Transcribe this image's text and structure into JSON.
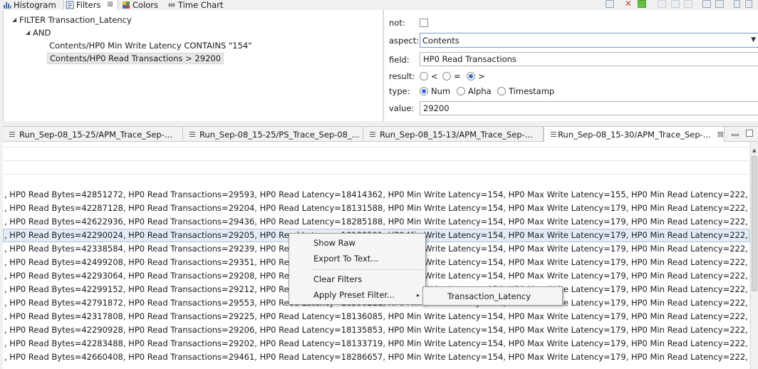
{
  "top_tabs": [
    {
      "label": "Histogram",
      "icon": "histogram-icon"
    },
    {
      "label": "Filters",
      "icon": "filter-icon",
      "close": "⊠"
    },
    {
      "label": "Colors",
      "icon": "colors-icon"
    },
    {
      "label": "Time Chart",
      "icon": "time-chart-icon"
    }
  ],
  "filter_tree": {
    "root": "FILTER Transaction_Latency",
    "and": "AND",
    "conditions": [
      "Contents/HP0 Min Write Latency CONTAINS \"154\"",
      "Contents/HP0 Read Transactions > 29200"
    ]
  },
  "properties": {
    "not_label": "not:",
    "aspect_label": "aspect:",
    "aspect_value": "Contents",
    "field_label": "field:",
    "field_value": "HP0 Read Transactions",
    "result_label": "result:",
    "result_options": [
      "<",
      "=",
      ">"
    ],
    "result_selected": ">",
    "type_label": "type:",
    "type_options": [
      "Num",
      "Alpha",
      "Timestamp"
    ],
    "type_selected": "Num",
    "value_label": "value:",
    "value_value": "29200"
  },
  "trace_tabs": [
    "Run_Sep-08_15-25/APM_Trace_Sep-...",
    "Run_Sep-08_15-25/PS_Trace_Sep-08_...",
    "Run_Sep-08_15-13/APM_Trace_Sep-...",
    "Run_Sep-08_15-30/APM_Trace_Sep-..."
  ],
  "log_rows": [
    ", HP0 Read Bytes=42851272, HP0 Read Transactions=29593, HP0 Read Latency=18414362, HP0 Min Write Latency=154, HP0 Max Write Latency=155, HP0 Min Read Latency=222, HP0 Max Read Late",
    ", HP0 Read Bytes=42287128, HP0 Read Transactions=29204, HP0 Read Latency=18131588, HP0 Min Write Latency=154, HP0 Max Write Latency=179, HP0 Min Read Latency=222, HP0 Max Read Late",
    ", HP0 Read Bytes=42622936, HP0 Read Transactions=29436, HP0 Read Latency=18285188, HP0 Min Write Latency=154, HP0 Max Write Latency=179, HP0 Min Read Latency=222, HP0 Max Read Late",
    ", HP0 Read Bytes=42290024, HP0 Read Transactions=29205, HP0 Read Latency=18133591, HP0 Min Write Latency=154, HP0 Max Write Latency=179, HP0 Min Read Latency=222, HP0 Max Read Late",
    ", HP0 Read Bytes=42338584, HP0 Read Transactions=29239, HP0 Read Latency=18163420, HP0 Min Write Latency=154, HP0 Max Write Latency=179, HP0 Min Read Latency=222, HP0 Max Read Late",
    ", HP0 Read Bytes=42499208, HP0 Read Transactions=29351, HP0 Read Latency=18231754, HP0 Min Write Latency=154, HP0 Max Write Latency=179, HP0 Min Read Latency=222, HP0 Max Read Late",
    ", HP0 Read Bytes=42293064, HP0 Read Transactions=29208, HP0 Read Latency=18134820, HP0 Min Write Latency=154, HP0 Max Write Latency=179, HP0 Min Read Latency=222, HP0 Max Read Late",
    ", HP0 Read Bytes=42299152, HP0 Read Transactions=29212, HP0 Read Latency=18137012, HP0 Min Write Latency=154, HP0 Max Write Latency=179, HP0 Min Read Latency=222, HP0 Max Read Late",
    ", HP0 Read Bytes=42791872, HP0 Read Transactions=29553, HP0 Read Latency=18390211, HP0 Min Write Latency=154, HP0 Max Write Latency=179, HP0 Min Read Latency=222, HP0 Max Read Late",
    ", HP0 Read Bytes=42317808, HP0 Read Transactions=29225, HP0 Read Latency=18136085, HP0 Min Write Latency=154, HP0 Max Write Latency=179, HP0 Min Read Latency=222, HP0 Max Read Late",
    ", HP0 Read Bytes=42290928, HP0 Read Transactions=29206, HP0 Read Latency=18135853, HP0 Min Write Latency=154, HP0 Max Write Latency=179, HP0 Min Read Latency=222, HP0 Max Read Late",
    ", HP0 Read Bytes=42283488, HP0 Read Transactions=29202, HP0 Read Latency=18133719, HP0 Min Write Latency=154, HP0 Max Write Latency=179, HP0 Min Read Latency=222, HP0 Max Read Late",
    ", HP0 Read Bytes=42660408, HP0 Read Transactions=29461, HP0 Read Latency=18286657, HP0 Min Write Latency=154, HP0 Max Write Latency=179, HP0 Min Read Latency=222, HP0 Max Read Late"
  ],
  "context_menu": {
    "items": [
      "Show Raw",
      "Export To Text...",
      "Clear Filters",
      "Apply Preset Filter..."
    ],
    "submenu_arrow": "▸",
    "submenu": [
      "Transaction_Latency"
    ]
  },
  "colors": {
    "selection": "#e4ecf7",
    "accent": "#2d6ad6"
  }
}
